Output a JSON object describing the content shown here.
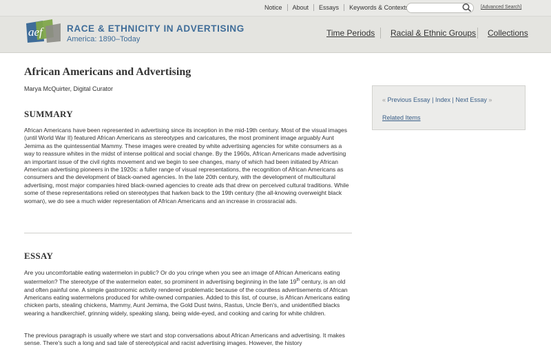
{
  "topnav": {
    "items": [
      "Notice",
      "About",
      "Essays",
      "Keywords & Contexts"
    ],
    "search_placeholder": "",
    "advanced_search": "[Advanced Search]"
  },
  "header": {
    "logo_text": "aef",
    "title": "RACE & ETHNICITY IN ADVERTISING",
    "subtitle": "America: 1890–Today",
    "nav": [
      "Time Periods",
      "Racial & Ethnic Groups",
      "Collections"
    ]
  },
  "article": {
    "title": "African Americans and Advertising",
    "author": "Marya McQuirter, Digital Curator",
    "summary_head": "SUMMARY",
    "summary_text": "African Americans have been represented in advertising since its inception in the mid-19th century. Most of the visual images (until World War II) featured African Americans as stereotypes and caricatures, the most prominent image arguably Aunt Jemima as the quintessential Mammy. These images were created by white advertising agencies for white consumers as a way to reassure whites in the midst of intense political and social change. By the 1960s, African Americans made advertising an important issue of the civil rights movement and we begin to see changes, many of which had been initiated by African American advertising pioneers in the 1920s: a fuller range of visual representations, the recognition of African Americans as consumers and the development of black-owned agencies. In the late 20th century, with the development of multicultural advertising, most major companies hired black-owned agencies to create ads that drew on perceived cultural traditions. While some of these representations relied on stereotypes that harken back to the 19th century (the all-knowing overweight black woman), we do see a much wider representation of African Americans and an increase in crossracial ads.",
    "essay_head": "ESSAY",
    "essay_p1_a": "Are you uncomfortable eating watermelon in public?  Or do you cringe when you see an image of African Americans eating watermelon?  The stereotype of the watermelon eater, so prominent in advertising beginning in the late 19",
    "essay_p1_sup": "th",
    "essay_p1_b": " century, is an old and often painful one.  A simple gastronomic activity rendered problematic because of the countless advertisements of African Americans eating watermelons produced for white-owned companies.  Added to this list, of course, is African Americans eating chicken parts, stealing chickens, Mammy, Aunt Jemima, the Gold Dust twins, Rastus, Uncle Ben's, and unidentified blacks wearing a handkerchief, grinning widely, speaking slang, being wide-eyed, and cooking and caring for white children.",
    "essay_p2": "The previous paragraph is usually where we start and stop conversations about African Americans and advertising.  It makes sense.  There's such a long and sad tale of stereotypical and racist advertising images.  However, the history"
  },
  "sidebar": {
    "prev": "Previous Essay",
    "sep": "|",
    "index": "Index",
    "next": "Next Essay",
    "related": "Related Items"
  },
  "colors": {
    "brand_blue": "#3f6d99",
    "link_blue": "#3a5f88"
  }
}
